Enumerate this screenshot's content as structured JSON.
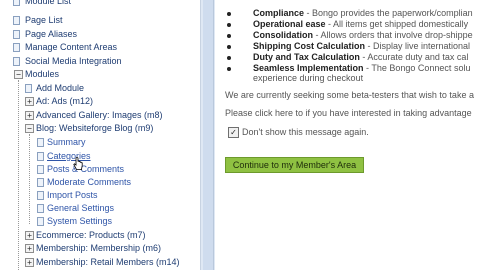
{
  "tree": {
    "items": [
      {
        "label": "Module List"
      },
      {
        "label": "Page List"
      },
      {
        "label": "Page Aliases"
      },
      {
        "label": "Manage Content Areas"
      },
      {
        "label": "Social Media Integration"
      },
      {
        "label": "Modules"
      },
      {
        "label": "Add Module"
      },
      {
        "label": "Ad: Ads (m12)"
      },
      {
        "label": "Advanced Gallery: Images (m8)"
      },
      {
        "label": "Blog: Websiteforge Blog (m9)"
      },
      {
        "label": "Summary"
      },
      {
        "label": "Categories"
      },
      {
        "label": "Posts & Comments"
      },
      {
        "label": "Moderate Comments"
      },
      {
        "label": "Import Posts"
      },
      {
        "label": "General Settings"
      },
      {
        "label": "System Settings"
      },
      {
        "label": "Ecommerce: Products (m7)"
      },
      {
        "label": "Membership: Membership (m6)"
      },
      {
        "label": "Membership: Retail Members (m14)"
      }
    ],
    "expand_minus": "−",
    "expand_plus": "+"
  },
  "main": {
    "bullets": [
      {
        "term": "Compliance",
        "desc": " - Bongo provides the paperwork/complian"
      },
      {
        "term": "Operational ease",
        "desc": " - All items get shipped domestically"
      },
      {
        "term": "Consolidation",
        "desc": " - Allows orders that involve drop-shippe"
      },
      {
        "term": "Shipping Cost Calculation",
        "desc": " - Display live international"
      },
      {
        "term": "Duty and Tax Calculation",
        "desc": " - Accurate duty and tax cal"
      },
      {
        "term": "Seamless Implementation",
        "desc": " - The Bongo Connect solu"
      }
    ],
    "bullet_continuation": "experience during checkout",
    "beta_text": "We are currently seeking some beta-testers that wish to take a",
    "click_text": "Please click here to if you have interested in taking advantage",
    "checkbox_label": "Don't show this message again.",
    "checkbox_mark": "✓",
    "button_label": "Continue to my Member's Area"
  },
  "colors": {
    "accent_green": "#8fc142",
    "link_blue": "#2f55a8"
  }
}
